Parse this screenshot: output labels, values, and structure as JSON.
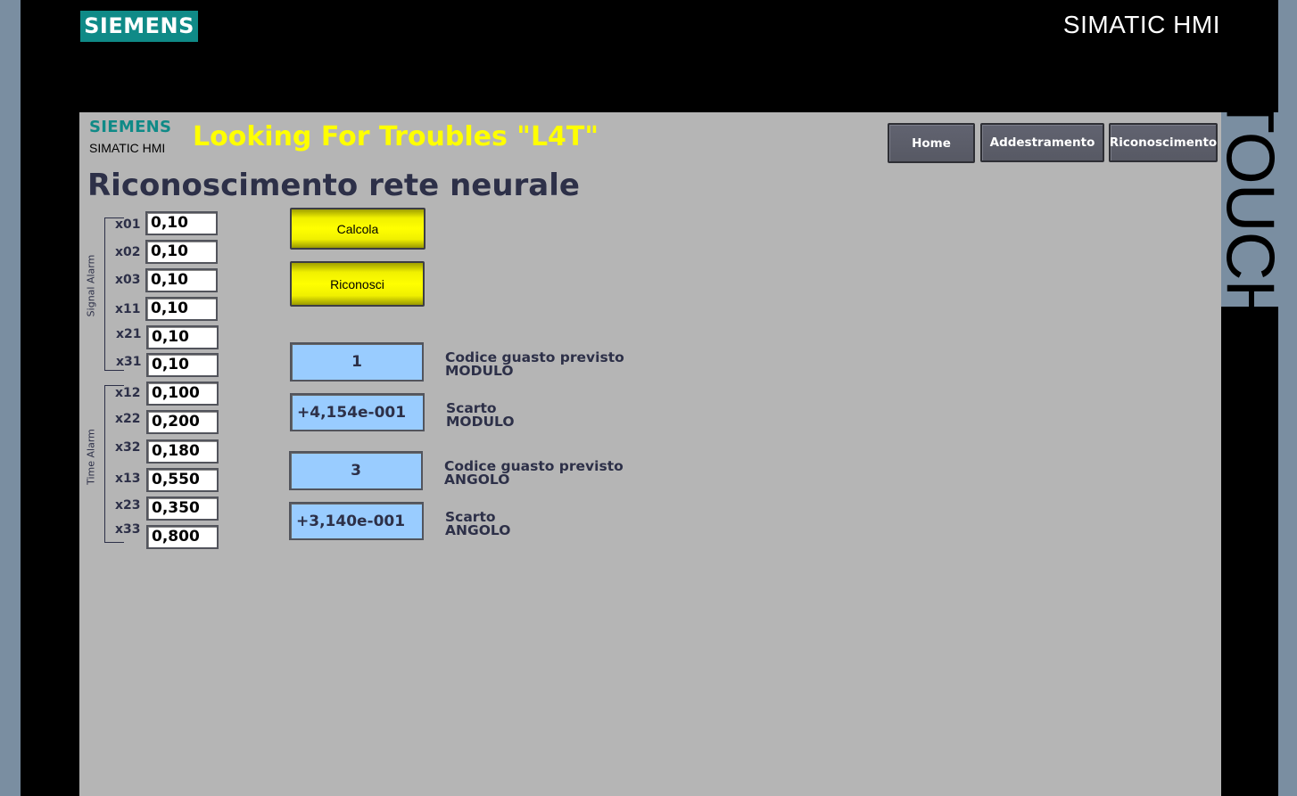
{
  "bezel": {
    "logo": "SIEMENS",
    "brand": "SIMATIC HMI",
    "side_label": "TOUCH"
  },
  "header": {
    "logo": "SIEMENS",
    "product": "SIMATIC HMI",
    "title": "Looking For Troubles \"L4T\""
  },
  "nav": [
    {
      "label": "Home"
    },
    {
      "label": "Addestramento"
    },
    {
      "label": "Riconoscimento"
    }
  ],
  "page_title": "Riconoscimento rete neurale",
  "signal_group": {
    "label": "Signal Alarm"
  },
  "time_group": {
    "label": "Time Alarm"
  },
  "inputs": [
    {
      "label": "x01",
      "value": "0,10"
    },
    {
      "label": "x02",
      "value": "0,10"
    },
    {
      "label": "x03",
      "value": "0,10"
    },
    {
      "label": "x11",
      "value": "0,10"
    },
    {
      "label": "x21",
      "value": "0,10"
    },
    {
      "label": "x31",
      "value": "0,10"
    },
    {
      "label": "x12",
      "value": "0,100"
    },
    {
      "label": "x22",
      "value": "0,200"
    },
    {
      "label": "x32",
      "value": "0,180"
    },
    {
      "label": "x13",
      "value": "0,550"
    },
    {
      "label": "x23",
      "value": "0,350"
    },
    {
      "label": "x33",
      "value": "0,800"
    }
  ],
  "actions": {
    "calcola": "Calcola",
    "riconosci": "Riconosci"
  },
  "outputs": [
    {
      "value": "1",
      "line1": "Codice guasto previsto",
      "line2": "MODULO"
    },
    {
      "value": "+4,154e-001",
      "line1": "Scarto",
      "line2": "MODULO"
    },
    {
      "value": "3",
      "line1": "Codice guasto previsto",
      "line2": "ANGOLO"
    },
    {
      "value": "+3,140e-001",
      "line1": "Scarto",
      "line2": "ANGOLO"
    }
  ],
  "colors": {
    "bezel": "#000000",
    "screen_bg": "#b5b5b5",
    "siemens_teal": "#0f8a87",
    "title_yellow": "#ffff00",
    "output_blue": "#99ccff",
    "text_navy": "#2d3048"
  }
}
